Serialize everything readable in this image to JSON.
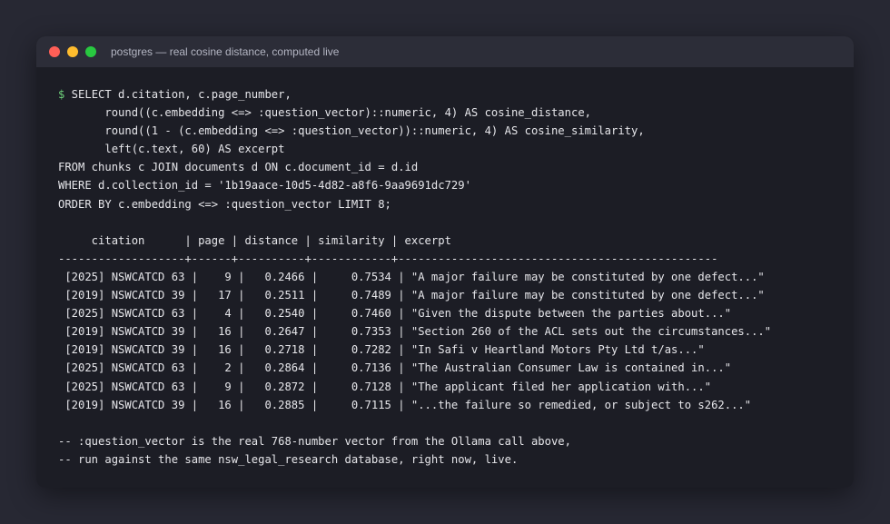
{
  "window": {
    "title": "postgres — real cosine distance, computed live"
  },
  "terminal": {
    "prompt": "$",
    "query_lines": [
      " SELECT d.citation, c.page_number,",
      "       round((c.embedding <=> :question_vector)::numeric, 4) AS cosine_distance,",
      "       round((1 - (c.embedding <=> :question_vector))::numeric, 4) AS cosine_similarity,",
      "       left(c.text, 60) AS excerpt",
      "FROM chunks c JOIN documents d ON c.document_id = d.id",
      "WHERE d.collection_id = '1b19aace-10d5-4d82-a8f6-9aa9691dc729'",
      "ORDER BY c.embedding <=> :question_vector LIMIT 8;"
    ],
    "table_header": "     citation      | page | distance | similarity | excerpt",
    "table_separator": "-------------------+------+----------+------------+------------------------------------------------",
    "table_rows": [
      " [2025] NSWCATCD 63 |    9 |   0.2466 |     0.7534 | \"A major failure may be constituted by one defect...\"",
      " [2019] NSWCATCD 39 |   17 |   0.2511 |     0.7489 | \"A major failure may be constituted by one defect...\"",
      " [2025] NSWCATCD 63 |    4 |   0.2540 |     0.7460 | \"Given the dispute between the parties about...\"",
      " [2019] NSWCATCD 39 |   16 |   0.2647 |     0.7353 | \"Section 260 of the ACL sets out the circumstances...\"",
      " [2019] NSWCATCD 39 |   16 |   0.2718 |     0.7282 | \"In Safi v Heartland Motors Pty Ltd t/as...\"",
      " [2025] NSWCATCD 63 |    2 |   0.2864 |     0.7136 | \"The Australian Consumer Law is contained in...\"",
      " [2025] NSWCATCD 63 |    9 |   0.2872 |     0.7128 | \"The applicant filed her application with...\"",
      " [2019] NSWCATCD 39 |   16 |   0.2885 |     0.7115 | \"...the failure so remedied, or subject to s262...\""
    ],
    "comments": [
      "-- :question_vector is the real 768-number vector from the Ollama call above,",
      "-- run against the same nsw_legal_research database, right now, live."
    ]
  },
  "colors": {
    "background": "#272833",
    "window": "#1c1d25",
    "titlebar": "#2c2d38",
    "prompt": "#6fd27c",
    "text": "#e6e6ea"
  }
}
